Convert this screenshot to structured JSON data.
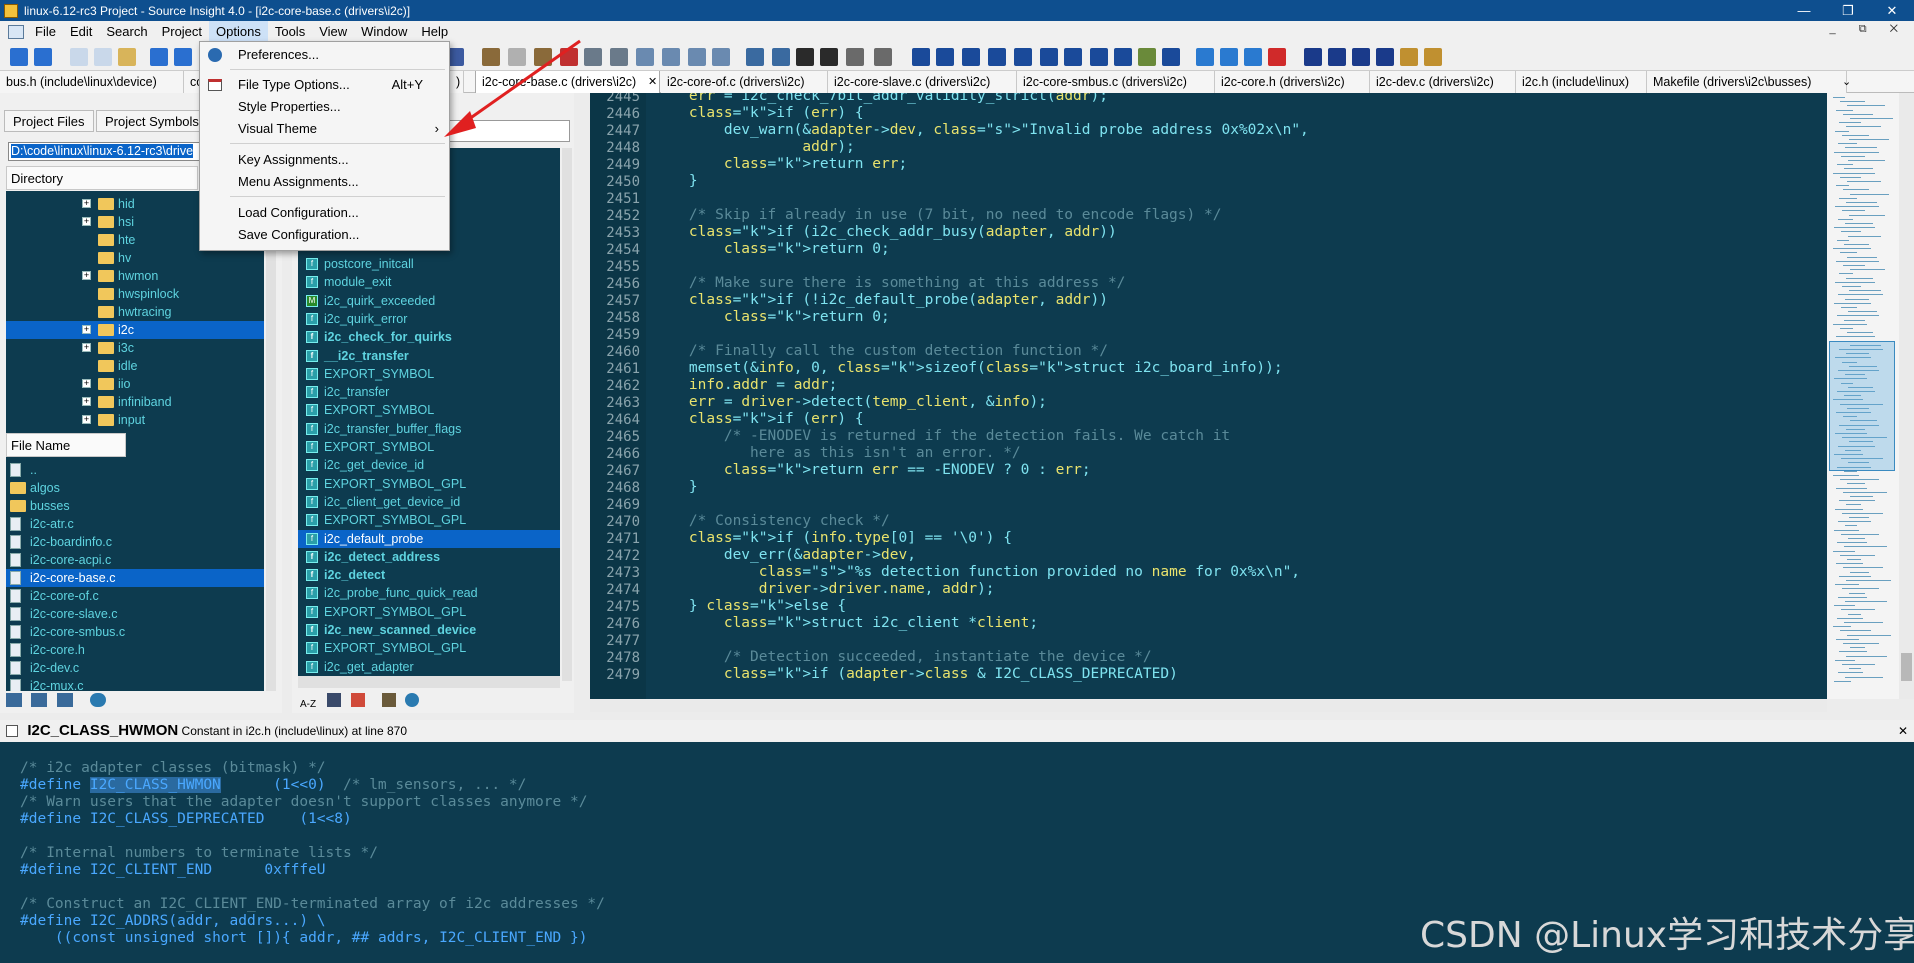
{
  "window": {
    "title": "linux-6.12-rc3 Project - Source Insight 4.0 - [i2c-core-base.c (drivers\\i2c)]"
  },
  "menubar": [
    "File",
    "Edit",
    "Search",
    "Project",
    "Options",
    "Tools",
    "View",
    "Window",
    "Help"
  ],
  "tabs": [
    "bus.h (include\\linux\\device)",
    "co",
    ")",
    "i2c-core-base.c (drivers\\i2c)",
    "i2c-core-of.c (drivers\\i2c)",
    "i2c-core-slave.c (drivers\\i2c)",
    "i2c-core-smbus.c (drivers\\i2c)",
    "i2c-core.h (drivers\\i2c)",
    "i2c-dev.c (drivers\\i2c)",
    "i2c.h (include\\linux)",
    "Makefile (drivers\\i2c\\busses)"
  ],
  "dropdown": {
    "items": [
      {
        "label": "Preferences..."
      },
      {
        "label": "File Type Options...",
        "shortcut": "Alt+Y"
      },
      {
        "label": "Style Properties..."
      },
      {
        "label": "Visual Theme"
      },
      {
        "label": "Key Assignments..."
      },
      {
        "label": "Menu Assignments..."
      },
      {
        "label": "Load Configuration..."
      },
      {
        "label": "Save Configuration..."
      }
    ]
  },
  "left": {
    "tab_files": "Project Files",
    "tab_symbols": "Project Symbols",
    "path": "D:\\code\\linux\\linux-6.12-rc3\\drive",
    "dir_header": "Directory",
    "dirs": [
      "hid",
      "hsi",
      "hte",
      "hv",
      "hwmon",
      "hwspinlock",
      "hwtracing",
      "i2c",
      "i3c",
      "idle",
      "iio",
      "infiniband",
      "input"
    ],
    "file_header": "File Name",
    "files": [
      "..",
      "algos",
      "busses",
      "i2c-atr.c",
      "i2c-boardinfo.c",
      "i2c-core-acpi.c",
      "i2c-core-base.c",
      "i2c-core-of.c",
      "i2c-core-slave.c",
      "i2c-core-smbus.c",
      "i2c-core.h",
      "i2c-dev.c",
      "i2c-mux.c"
    ]
  },
  "symbols": [
    "postcore_initcall",
    "module_exit",
    "i2c_quirk_exceeded",
    "i2c_quirk_error",
    "i2c_check_for_quirks",
    "__i2c_transfer",
    "EXPORT_SYMBOL",
    "i2c_transfer",
    "EXPORT_SYMBOL",
    "i2c_transfer_buffer_flags",
    "EXPORT_SYMBOL",
    "i2c_get_device_id",
    "EXPORT_SYMBOL_GPL",
    "i2c_client_get_device_id",
    "EXPORT_SYMBOL_GPL",
    "i2c_default_probe",
    "i2c_detect_address",
    "i2c_detect",
    "i2c_probe_func_quick_read",
    "EXPORT_SYMBOL_GPL",
    "i2c_new_scanned_device",
    "EXPORT_SYMBOL_GPL",
    "i2c_get_adapter"
  ],
  "code_lines": [
    "2445",
    "2446",
    "2447",
    "2448",
    "2449",
    "2450",
    "2451",
    "2452",
    "2453",
    "2454",
    "2455",
    "2456",
    "2457",
    "2458",
    "2459",
    "2460",
    "2461",
    "2462",
    "2463",
    "2464",
    "2465",
    "2466",
    "2467",
    "2468",
    "2469",
    "2470",
    "2471",
    "2472",
    "2473",
    "2474",
    "2475",
    "2476",
    "2477",
    "2478",
    "2479"
  ],
  "code": [
    "    err = i2c_check_7bit_addr_validity_strict(addr);",
    "    if (err) {",
    "        dev_warn(&adapter->dev, \"Invalid probe address 0x%02x\\n\",",
    "                 addr);",
    "        return err;",
    "    }",
    "",
    "    /* Skip if already in use (7 bit, no need to encode flags) */",
    "    if (i2c_check_addr_busy(adapter, addr))",
    "        return 0;",
    "",
    "    /* Make sure there is something at this address */",
    "    if (!i2c_default_probe(adapter, addr))",
    "        return 0;",
    "",
    "    /* Finally call the custom detection function */",
    "    memset(&info, 0, sizeof(struct i2c_board_info));",
    "    info.addr = addr;",
    "    err = driver->detect(temp_client, &info);",
    "    if (err) {",
    "        /* -ENODEV is returned if the detection fails. We catch it",
    "           here as this isn't an error. */",
    "        return err == -ENODEV ? 0 : err;",
    "    }",
    "",
    "    /* Consistency check */",
    "    if (info.type[0] == '\\0') {",
    "        dev_err(&adapter->dev,",
    "            \"%s detection function provided no name for 0x%x\\n\",",
    "            driver->driver.name, addr);",
    "    } else {",
    "        struct i2c_client *client;",
    "",
    "        /* Detection succeeded, instantiate the device */",
    "        if (adapter->class & I2C_CLASS_DEPRECATED)"
  ],
  "context": {
    "symbol": "I2C_CLASS_HWMON",
    "desc": "Constant in i2c.h (include\\linux) at line 870",
    "lines": [
      "/* i2c adapter classes (bitmask) */",
      "#define I2C_CLASS_HWMON      (1<<0)  /* lm_sensors, ... */",
      "/* Warn users that the adapter doesn't support classes anymore */",
      "#define I2C_CLASS_DEPRECATED    (1<<8)",
      "",
      "/* Internal numbers to terminate lists */",
      "#define I2C_CLIENT_END      0xfffeU",
      "",
      "/* Construct an I2C_CLIENT_END-terminated array of i2c addresses */",
      "#define I2C_ADDRS(addr, addrs...) \\",
      "    ((const unsigned short []){ addr, ## addrs, I2C_CLIENT_END })"
    ]
  },
  "watermark": "CSDN @Linux学习和技术分享"
}
